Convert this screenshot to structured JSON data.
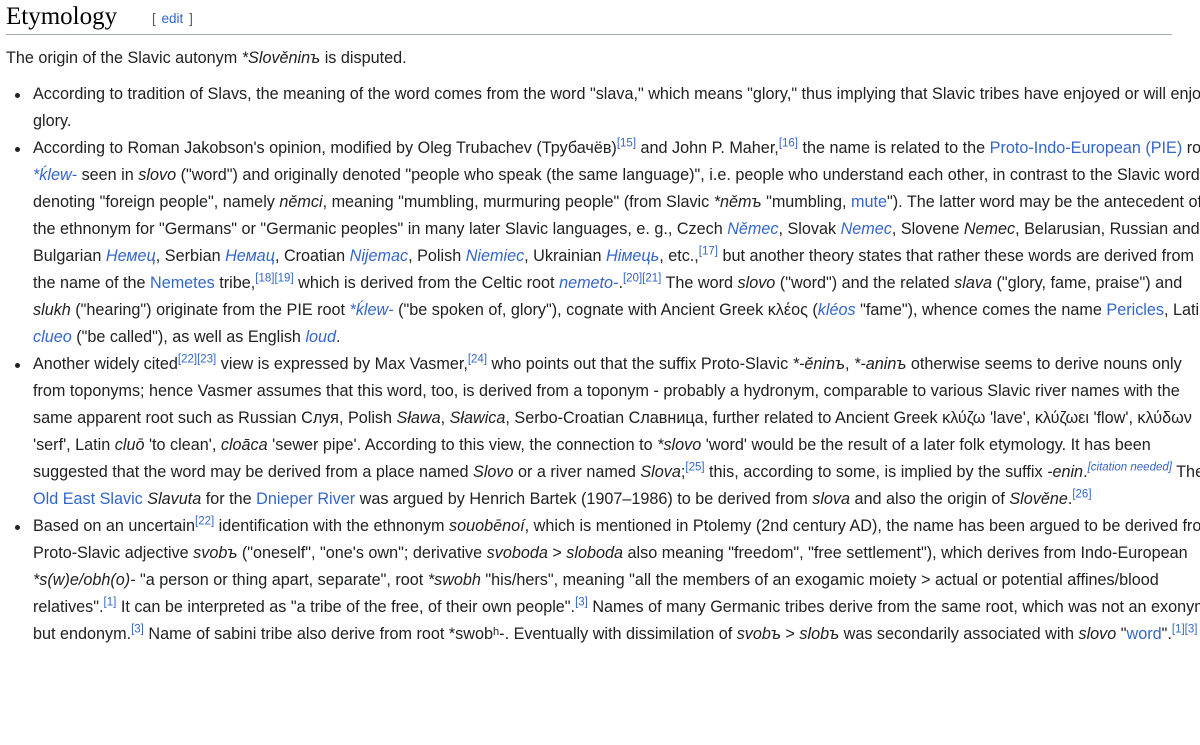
{
  "section": {
    "title": "Etymology",
    "edit_bracket_open": "[",
    "edit_label": "edit",
    "edit_bracket_close": "]"
  },
  "intro": {
    "t1": "The origin of the Slavic autonym ",
    "i1": "*Slověninъ",
    "t2": " is disputed."
  },
  "b1": {
    "t1": "According to tradition of Slavs, the meaning of the word comes from the word \"slava,\" which means \"glory,\" thus implying that Slavic tribes have enjoyed or will enjoy glory."
  },
  "b2": {
    "t1": "According to Roman Jakobson's opinion, modified by Oleg Trubachev (Трубачёв)",
    "r1": "[15]",
    "t2": " and John P. Maher,",
    "r2": "[16]",
    "t3": " the name is related to the ",
    "l1": "Proto-Indo-European (PIE)",
    "t4": " root ",
    "l2": "*ḱlew-",
    "t5": " seen in ",
    "i1": "slovo",
    "t6": " (\"word\") and originally denoted \"people who speak (the same language)\", i.e. people who understand each other, in contrast to the Slavic word denoting \"foreign people\", namely ",
    "i2": "němci",
    "t7": ", meaning \"mumbling, murmuring people\" (from Slavic ",
    "i3": "*němъ",
    "t8": " \"mumbling, ",
    "l3": "mute",
    "t9": "\"). The latter word may be the antecedent of the ethnonym for \"Germans\" or \"Germanic peoples\" in many later Slavic languages, e. g., Czech ",
    "l4": "Němec",
    "t10": ", Slovak ",
    "l5": "Nemec",
    "t11": ", Slovene ",
    "i4": "Nemec",
    "t12": ", Belarusian, Russian and Bulgarian ",
    "l6": "Немец",
    "t13": ", Serbian ",
    "l7": "Немац",
    "t14": ", Croatian ",
    "l8": "Nijemac",
    "t15": ", Polish ",
    "l9": "Niemiec",
    "t16": ", Ukrainian ",
    "l10": "Німець",
    "t17": ", etc.,",
    "r3": "[17]",
    "t18": " but another theory states that rather these words are derived from the name of the ",
    "l11": "Nemetes",
    "t19": " tribe,",
    "r4": "[18]",
    "r5": "[19]",
    "t20": " which is derived from the Celtic root ",
    "l12": "nemeto-",
    "t21": ".",
    "r6": "[20]",
    "r7": "[21]",
    "t22": " The word ",
    "i5": "slovo",
    "t23": " (\"word\") and the related ",
    "i6": "slava",
    "t24": " (\"glory, fame, praise\") and ",
    "i7": "slukh",
    "t25": " (\"hearing\") originate from the PIE root ",
    "l13": "*ḱlew-",
    "t26": " (\"be spoken of, glory\"), cognate with Ancient Greek κλέος (",
    "l14": "kléos",
    "t27": " \"fame\"), whence comes the name ",
    "l15": "Pericles",
    "t28": ", Latin ",
    "l16": "clueo",
    "t29": " (\"be called\"), as well as English ",
    "l17": "loud",
    "t30": "."
  },
  "b3": {
    "t1": "Another widely cited",
    "r1": "[22]",
    "r2": "[23]",
    "t2": " view is expressed by Max Vasmer,",
    "r3": "[24]",
    "t3": " who points out that the suffix Proto-Slavic ",
    "i1": "*-ěninъ",
    "t4": ", ",
    "i2": "*-aninъ",
    "t5": " otherwise seems to derive nouns only from toponyms; hence Vasmer assumes that this word, too, is derived from a toponym - probably a hydronym, comparable to various Slavic river names with the same apparent root such as Russian Слуя, Polish ",
    "i3": "Sława",
    "t6": ", ",
    "i4": "Sławica",
    "t7": ", Serbo-Croatian Славница, further related to Ancient Greek κλύζω 'lave', κλύζωει 'flow', κλύδων 'serf', Latin ",
    "i5": "cluō",
    "t8": " 'to clean', ",
    "i6": "cloāca",
    "t9": " 'sewer pipe'. According to this view, the connection to ",
    "i7": "*slovo",
    "t10": " 'word' would be the result of a later folk etymology. It has been suggested that the word may be derived from a place named ",
    "i8": "Slovo",
    "t11": " or a river named ",
    "i9": "Slova",
    "t12": ";",
    "r4": "[25]",
    "t13": " this, according to some, is implied by the suffix ",
    "i10": "-enin",
    "t14": ".",
    "cn": "[citation needed]",
    "t15": " The ",
    "l1": "Old East Slavic",
    "t16": " ",
    "i11": "Slavuta",
    "t17": " for the ",
    "l2": "Dnieper River",
    "t18": " was argued by Henrich Bartek (1907–1986) to be derived from ",
    "i12": "slova",
    "t19": " and also the origin of ",
    "i13": "Slověne",
    "t20": ".",
    "r5": "[26]"
  },
  "b4": {
    "t1": "Based on an uncertain",
    "r1": "[22]",
    "t2": " identification with the ethnonym ",
    "i1": "souobēnoí",
    "t3": ", which is mentioned in Ptolemy (2nd century AD), the name has been argued to be derived from Proto-Slavic adjective ",
    "i2": "svobъ",
    "t4": " (\"oneself\", \"one's own\"; derivative ",
    "i3": "svoboda",
    "t5": " > ",
    "i4": "sloboda",
    "t6": " also meaning \"freedom\", \"free settlement\"), which derives from Indo-European ",
    "i5": "*s(w)e/obh(o)-",
    "t7": " \"a person or thing apart, separate\", root ",
    "i6": "*swobh",
    "t8": " \"his/hers\", meaning \"all the members of an exogamic moiety > actual or potential affines/blood relatives\".",
    "r2": "[1]",
    "t9": " It can be interpreted as \"a tribe of the free, of their own people\".",
    "r3": "[3]",
    "t10": " Names of many Germanic tribes derive from the same root, which was not an exonym but endonym.",
    "r4": "[3]",
    "t11": " Name of sabini tribe also derive from root *swobʰ-. Eventually with dissimilation of ",
    "i7": "svobъ",
    "t12": " > ",
    "i8": "slobъ",
    "t13": " was secondarily associated with ",
    "i9": "slovo",
    "t14": " \"",
    "l1": "word",
    "t15": "\".",
    "r5": "[1]",
    "r6": "[3]"
  }
}
